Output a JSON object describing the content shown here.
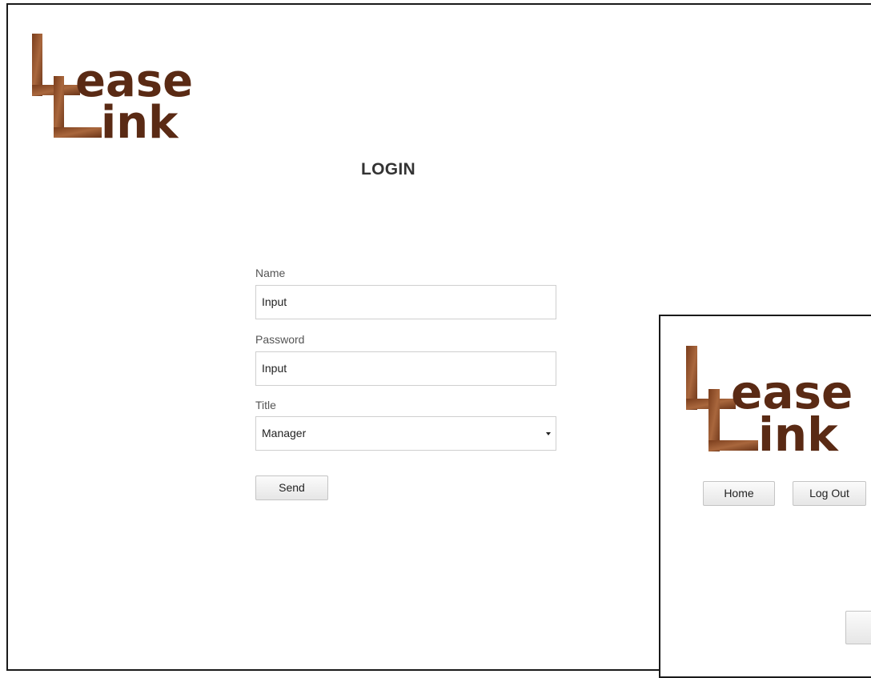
{
  "main_window": {
    "logo": {
      "line1": "ease",
      "line2": "ink"
    },
    "heading": "LOGIN",
    "form": {
      "name_label": "Name",
      "name_value": "Input",
      "password_label": "Password",
      "password_value": "Input",
      "title_label": "Title",
      "title_selected": "Manager",
      "send_label": "Send"
    }
  },
  "second_window": {
    "logo": {
      "line1": "ease",
      "line2": "ink"
    },
    "nav": {
      "home_label": "Home",
      "logout_label": "Log Out"
    }
  },
  "colors": {
    "logo_brown": "#5a2a14",
    "logo_wood": "#9a5a34",
    "border": "#1a1a1a"
  },
  "icons": [
    "chevron-down-icon"
  ]
}
